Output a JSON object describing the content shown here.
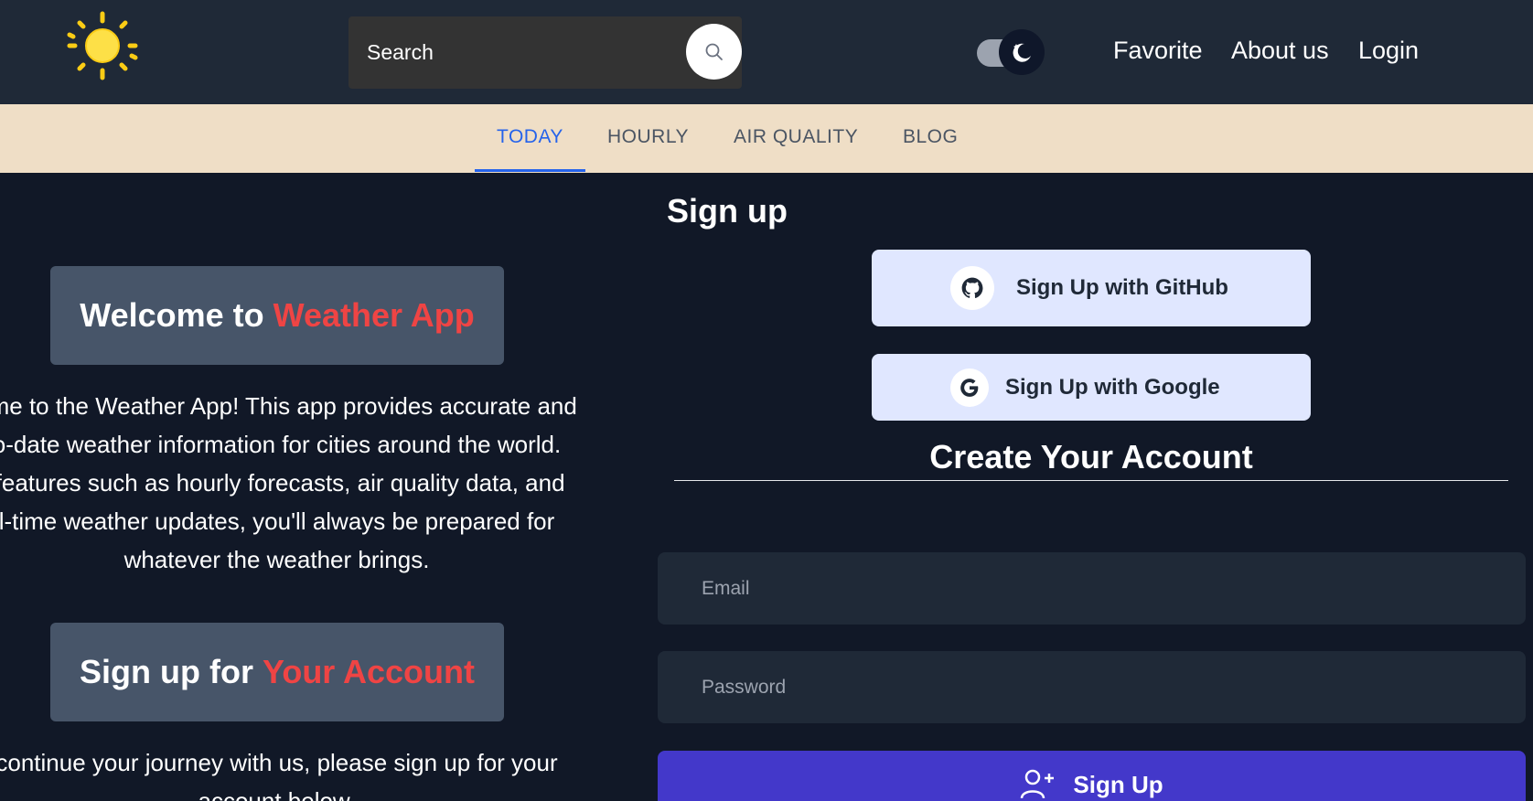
{
  "header": {
    "logo_icon": "sun-icon",
    "search": {
      "label": "Search",
      "icon": "search-icon"
    },
    "theme_toggle": {
      "icon": "moon-icon",
      "state": "dark"
    },
    "nav": {
      "favorite": "Favorite",
      "about": "About us",
      "login": "Login"
    }
  },
  "tabs": {
    "today": "TODAY",
    "hourly": "HOURLY",
    "air_quality": "AIR QUALITY",
    "blog": "BLOG",
    "active": "TODAY"
  },
  "left": {
    "welcome": {
      "prefix": "Welcome to ",
      "accent": "Weather App"
    },
    "welcome_lines": [
      "ome to the Weather App! This app provides accurate and",
      "o-date weather information for cities around the world.",
      " features such as hourly forecasts, air quality data, and",
      "l-time weather updates, you'll always be prepared for",
      "whatever the weather brings."
    ],
    "signup_heading": {
      "prefix": "Sign up for ",
      "accent": "Your Account"
    },
    "signup_lines": [
      "continue your journey with us, please sign up for your",
      "account below."
    ]
  },
  "right": {
    "title": "Sign up",
    "github_button": "Sign Up with GitHub",
    "google_button": "Sign Up with Google",
    "create_title": "Create Your Account",
    "email_placeholder": "Email",
    "password_placeholder": "Password",
    "submit_label": "Sign Up"
  },
  "colors": {
    "accent": "#ef4444",
    "primary": "#4338ca",
    "tab_active": "#2563eb",
    "tab_bar": "#efdec6",
    "header_bg": "#1f2937",
    "page_bg": "#111827"
  }
}
